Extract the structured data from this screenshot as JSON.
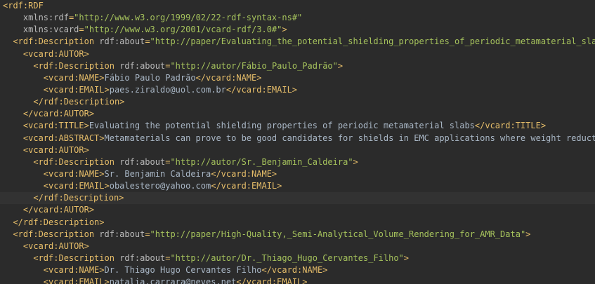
{
  "editor": {
    "lines": [
      {
        "indent": 0,
        "segs": [
          {
            "t": "tag",
            "v": "<rdf:RDF"
          }
        ]
      },
      {
        "indent": 2,
        "segs": [
          {
            "t": "attr",
            "v": "xmlns:rdf"
          },
          {
            "t": "tag",
            "v": "="
          },
          {
            "t": "val",
            "v": "\"http://www.w3.org/1999/02/22-rdf-syntax-ns#\""
          }
        ]
      },
      {
        "indent": 2,
        "segs": [
          {
            "t": "attr",
            "v": "xmlns:vcard"
          },
          {
            "t": "tag",
            "v": "="
          },
          {
            "t": "val",
            "v": "\"http://www.w3.org/2001/vcard-rdf/3.0#\""
          },
          {
            "t": "tag",
            "v": ">"
          }
        ]
      },
      {
        "indent": 1,
        "segs": [
          {
            "t": "tag",
            "v": "<rdf:Description "
          },
          {
            "t": "attr",
            "v": "rdf:about"
          },
          {
            "t": "tag",
            "v": "="
          },
          {
            "t": "val",
            "v": "\"http://paper/Evaluating_the_potential_shielding_properties_of_periodic_metamaterial_slabs\""
          },
          {
            "t": "tag",
            "v": ">"
          }
        ]
      },
      {
        "indent": 2,
        "segs": [
          {
            "t": "tag",
            "v": "<vcard:AUTOR>"
          }
        ]
      },
      {
        "indent": 3,
        "segs": [
          {
            "t": "tag",
            "v": "<rdf:Description "
          },
          {
            "t": "attr",
            "v": "rdf:about"
          },
          {
            "t": "tag",
            "v": "="
          },
          {
            "t": "val",
            "v": "\"http://autor/Fábio_Paulo_Padrão\""
          },
          {
            "t": "tag",
            "v": ">"
          }
        ]
      },
      {
        "indent": 4,
        "segs": [
          {
            "t": "tag",
            "v": "<vcard:NAME>"
          },
          {
            "t": "txt",
            "v": "Fábio Paulo Padrão"
          },
          {
            "t": "tag",
            "v": "</vcard:NAME>"
          }
        ]
      },
      {
        "indent": 4,
        "segs": [
          {
            "t": "tag",
            "v": "<vcard:EMAIL>"
          },
          {
            "t": "txt",
            "v": "paes.ziraldo@uol.com.br"
          },
          {
            "t": "tag",
            "v": "</vcard:EMAIL>"
          }
        ]
      },
      {
        "indent": 3,
        "segs": [
          {
            "t": "tag",
            "v": "</rdf:Description>"
          }
        ]
      },
      {
        "indent": 2,
        "segs": [
          {
            "t": "tag",
            "v": "</vcard:AUTOR>"
          }
        ]
      },
      {
        "indent": 2,
        "segs": [
          {
            "t": "tag",
            "v": "<vcard:TITLE>"
          },
          {
            "t": "txt",
            "v": "Evaluating the potential shielding properties of periodic metamaterial slabs"
          },
          {
            "t": "tag",
            "v": "</vcard:TITLE>"
          }
        ]
      },
      {
        "indent": 2,
        "segs": [
          {
            "t": "tag",
            "v": "<vcard:ABSTRACT>"
          },
          {
            "t": "txt",
            "v": "Metamaterials can prove to be good candidates for shields in EMC applications where weight reduction"
          }
        ]
      },
      {
        "indent": 2,
        "segs": [
          {
            "t": "tag",
            "v": "<vcard:AUTOR>"
          }
        ]
      },
      {
        "indent": 3,
        "segs": [
          {
            "t": "tag",
            "v": "<rdf:Description "
          },
          {
            "t": "attr",
            "v": "rdf:about"
          },
          {
            "t": "tag",
            "v": "="
          },
          {
            "t": "val",
            "v": "\"http://autor/Sr._Benjamin_Caldeira\""
          },
          {
            "t": "tag",
            "v": ">"
          }
        ]
      },
      {
        "indent": 4,
        "segs": [
          {
            "t": "tag",
            "v": "<vcard:NAME>"
          },
          {
            "t": "txt",
            "v": "Sr. Benjamin Caldeira"
          },
          {
            "t": "tag",
            "v": "</vcard:NAME>"
          }
        ]
      },
      {
        "indent": 4,
        "segs": [
          {
            "t": "tag",
            "v": "<vcard:EMAIL>"
          },
          {
            "t": "txt",
            "v": "obalestero@yahoo.com"
          },
          {
            "t": "tag",
            "v": "</vcard:EMAIL>"
          }
        ]
      },
      {
        "indent": 3,
        "current": true,
        "segs": [
          {
            "t": "tag",
            "v": "</rdf:Desc"
          },
          {
            "t": "caret",
            "v": ""
          },
          {
            "t": "tag",
            "v": "ription>"
          }
        ]
      },
      {
        "indent": 2,
        "segs": [
          {
            "t": "tag",
            "v": "</vcard:AUTOR>"
          }
        ]
      },
      {
        "indent": 1,
        "segs": [
          {
            "t": "tag",
            "v": "</rdf:Description>"
          }
        ]
      },
      {
        "indent": 1,
        "segs": [
          {
            "t": "tag",
            "v": "<rdf:Description "
          },
          {
            "t": "attr",
            "v": "rdf:about"
          },
          {
            "t": "tag",
            "v": "="
          },
          {
            "t": "val",
            "v": "\"http://paper/High-Quality,_Semi-Analytical_Volume_Rendering_for_AMR_Data\""
          },
          {
            "t": "tag",
            "v": ">"
          }
        ]
      },
      {
        "indent": 2,
        "segs": [
          {
            "t": "tag",
            "v": "<vcard:AUTOR>"
          }
        ]
      },
      {
        "indent": 3,
        "segs": [
          {
            "t": "tag",
            "v": "<rdf:Description "
          },
          {
            "t": "attr",
            "v": "rdf:about"
          },
          {
            "t": "tag",
            "v": "="
          },
          {
            "t": "val",
            "v": "\"http://autor/Dr._Thiago_Hugo_Cervantes_Filho\""
          },
          {
            "t": "tag",
            "v": ">"
          }
        ]
      },
      {
        "indent": 4,
        "segs": [
          {
            "t": "tag",
            "v": "<vcard:NAME>"
          },
          {
            "t": "txt",
            "v": "Dr. Thiago Hugo Cervantes Filho"
          },
          {
            "t": "tag",
            "v": "</vcard:NAME>"
          }
        ]
      },
      {
        "indent": 4,
        "segs": [
          {
            "t": "tag",
            "v": "<vcard:EMAIL>"
          },
          {
            "t": "txt",
            "v": "natalia.carrara@neves.net"
          },
          {
            "t": "tag",
            "v": "</vcard:EMAIL>"
          }
        ]
      }
    ]
  }
}
